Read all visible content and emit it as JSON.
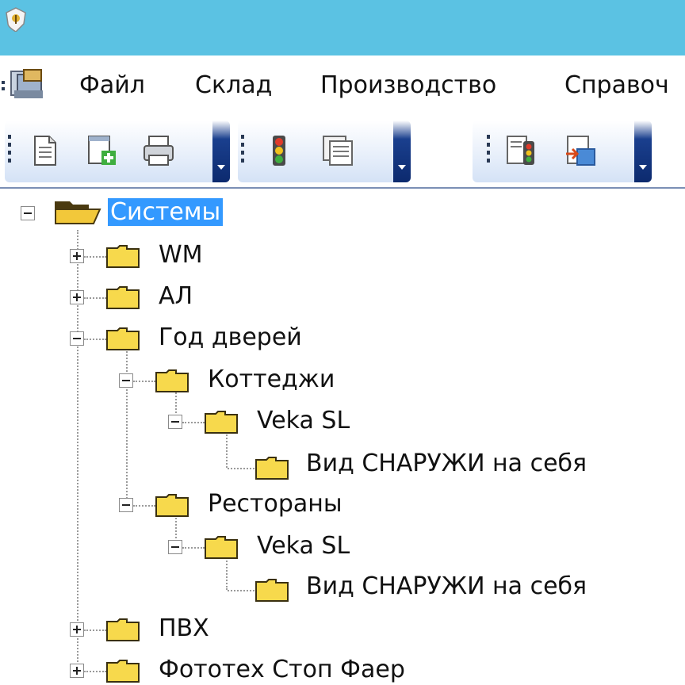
{
  "menu": {
    "items": [
      "Файл",
      "Склад",
      "Производство",
      "Справоч"
    ]
  },
  "toolbar": {
    "groups": [
      {
        "buttons": [
          "document-icon",
          "add-document-icon",
          "printer-icon"
        ]
      },
      {
        "buttons": [
          "traffic-light-icon",
          "list-window-icon"
        ]
      },
      {
        "buttons": [
          "traffic-light-document-icon",
          "export-document-icon"
        ]
      }
    ]
  },
  "tree": {
    "root": "Системы",
    "wm": "WM",
    "al": "АЛ",
    "god": "Год дверей",
    "cottages": "Коттеджи",
    "veka1": "Veka SL",
    "vid1": "Вид СНАРУЖИ на себя",
    "restaurants": "Рестораны",
    "veka2": "Veka SL",
    "vid2": "Вид СНАРУЖИ на себя",
    "pvc": "ПВХ",
    "fototex": "Фототех Стоп Фаер"
  },
  "colors": {
    "titlebar": "#5bc2e3",
    "selection": "#3399ff",
    "folder": "#f7d94c"
  }
}
